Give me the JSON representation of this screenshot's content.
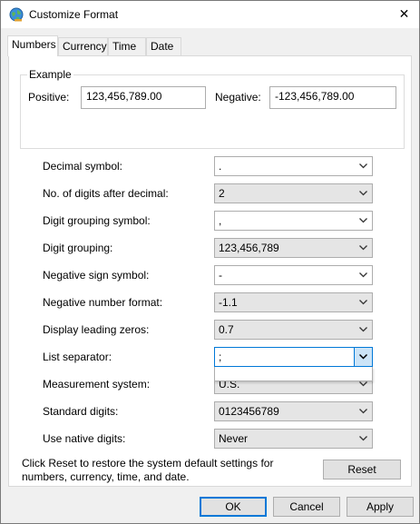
{
  "window": {
    "title": "Customize Format",
    "close_glyph": "✕"
  },
  "tabs": [
    {
      "label": "Numbers",
      "active": true
    },
    {
      "label": "Currency",
      "active": false
    },
    {
      "label": "Time",
      "active": false
    },
    {
      "label": "Date",
      "active": false
    }
  ],
  "example": {
    "legend": "Example",
    "positive_label": "Positive:",
    "positive_value": "123,456,789.00",
    "negative_label": "Negative:",
    "negative_value": "-123,456,789.00"
  },
  "settings": [
    {
      "label": "Decimal symbol:",
      "value": "."
    },
    {
      "label": "No. of digits after decimal:",
      "value": "2"
    },
    {
      "label": "Digit grouping symbol:",
      "value": ","
    },
    {
      "label": "Digit grouping:",
      "value": "123,456,789"
    },
    {
      "label": "Negative sign symbol:",
      "value": "-"
    },
    {
      "label": "Negative number format:",
      "value": "-1.1"
    },
    {
      "label": "Display leading zeros:",
      "value": "0.7"
    },
    {
      "label": "List separator:",
      "value": ";"
    },
    {
      "label": "Measurement system:",
      "value": "U.S."
    },
    {
      "label": "Standard digits:",
      "value": "0123456789"
    },
    {
      "label": "Use native digits:",
      "value": "Never"
    }
  ],
  "reset_info": "Click Reset to restore the system default settings for numbers, currency, time, and date.",
  "buttons": {
    "reset": "Reset",
    "ok": "OK",
    "cancel": "Cancel",
    "apply": "Apply"
  },
  "icons": {
    "title": "globe-icon",
    "dropdown": "chevron-down-icon"
  },
  "colors": {
    "focus_accent": "#0078d7",
    "focus_arrow_bg": "#cce4f7"
  }
}
